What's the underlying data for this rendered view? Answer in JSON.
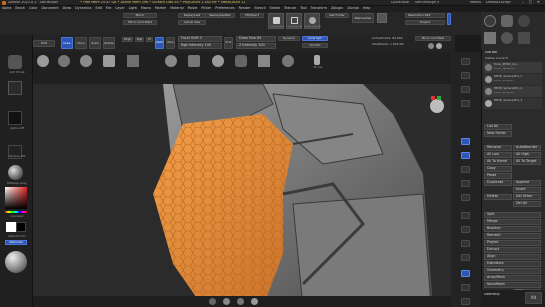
{
  "titlebar": {
    "title": "ZBrush 2022.0.1 · ZBrushDoc",
    "stats": "• Free Mem 25.47 GB • Active Mem 598 • Scratch Disk 45 • PolyCount 1.160 MP • MeshCount 11",
    "quicksave": "QuickSave",
    "seethrough": "See-through 0",
    "menus_label": "Menus",
    "default_zscript": "DefaultZScript"
  },
  "menubar": [
    "Alpha",
    "Brush",
    "Color",
    "Document",
    "Draw",
    "Dynamics",
    "Edit",
    "File",
    "Layer",
    "Light",
    "Macro",
    "Marker",
    "Material",
    "Movie",
    "Picker",
    "Preferences",
    "Render",
    "Stencil",
    "Stroke",
    "Texture",
    "Tool",
    "Transform",
    "Zplugin",
    "Zscript",
    "Help"
  ],
  "toolbar_top": {
    "mirror": "Mirror",
    "mirror_weld": "Mirror And Weld",
    "replay_last": "ReplayLast",
    "replay_last_rel": "ReplayLastRel",
    "actual_size": "Actual Size",
    "fill_object": "FillObject",
    "dynamesh": "DynaMesh",
    "zremesher": "ZRemesher",
    "zremesh_guide": "ZRemesherGuide",
    "get_folder": "Get Folder",
    "zremesh2": "ZRemesher",
    "resolution": "Resolution 464",
    "projection": "Project",
    "backface": "BackfaceMask",
    "subtool_label": "Subtool"
  },
  "toolbar_second": {
    "label": "GALAXIS_SITE",
    "edit_btn": "Edit",
    "draw": "Draw",
    "move": "Move",
    "scale": "Scale",
    "rotate": "Rotate",
    "mrgb": "Mrgb",
    "rgb": "Rgb",
    "m": "M",
    "zadd": "Zadd",
    "zsub": "Zsub",
    "zcut": "Zcut",
    "focal_shift": "Focal Shift 0",
    "draw_size": "Draw Size 64",
    "rgb_intensity": "Rgb Intensity 100",
    "z_intensity": "Z Intensity 100",
    "dyn": "Dynamic",
    "active_points": "ActivePoints: 82,682",
    "total_points": "TotalPoints: 1.622 Mil",
    "local_sym": "Local Sym",
    "mirror_x": "Mirror And Weld",
    "smooth": "Smooth"
  },
  "brush_row": {
    "label": "BrushRow",
    "items": [
      "Standard",
      "Move",
      "ClayBuildup",
      "DamStandard",
      "hPolish",
      "TrimDynamic",
      "Inflate",
      "Pinch",
      "SnakeHook",
      "Slash",
      "Chisel",
      "Cloth",
      "Prune"
    ],
    "prune": "Prune"
  },
  "left_panel": {
    "add_mode": "Add Mode",
    "alpha_off": "Alpha Off",
    "texture_off": "Texture Off",
    "matcap_gray": "MatCap Gray",
    "gradient": "Gradient",
    "switch_color": "SwitchColor",
    "alternate": "Alternate"
  },
  "right_panel": {
    "header": "SubTool",
    "visible_count": "Visible Count 8",
    "items": [
      {
        "name": "Torso_PM3D_Cyl...",
        "sub": "PM3D_Sphere3D"
      },
      {
        "name": "PM3D_Sphere3D1_1",
        "sub": "PM3D_Ring3D1"
      },
      {
        "name": "PM3D_Sphere3D1_2",
        "sub": "PM3D_Ring3D2"
      },
      {
        "name": "PM3D_Sphere3D1_3",
        "sub": ""
      }
    ],
    "list_all": "List All",
    "new_folder": "New Folder",
    "rename": "Rename",
    "auto_reorder": "AutoReorder",
    "all_low": "All Low",
    "all_high": "All High",
    "all_to_home": "All To Home",
    "all_to_target": "All To Target",
    "copy": "Copy",
    "paste": "Paste",
    "duplicate": "Duplicate",
    "append": "Append",
    "insert": "Insert",
    "delete": "Delete",
    "del_other": "Del Other",
    "del_all": "Del All",
    "split": "Split",
    "merge": "Merge",
    "boolean": "Boolean",
    "remesh": "Remesh",
    "project": "Project",
    "extract": "Extract",
    "align": "Align",
    "distribute": "Distribute",
    "geometry": "Geometry",
    "array_mesh": "ArrayMesh",
    "nanomesh": "NanoMesh",
    "layers": "Layers",
    "fibermesh": "FiberMesh",
    "geometry_hd": "Geometry HD",
    "preview": "Preview",
    "surface": "Surface",
    "deformation": "Deformation",
    "alt_btn": "Alt",
    "subtitle": "Geometry",
    "x_flip": "Y Flip",
    "total_btn": "Total"
  },
  "right_icons": [
    "Scroll",
    "Zoom",
    "Actual",
    "AAHalf",
    "Persp",
    "Floor",
    "Local",
    "LSym",
    "Xyz",
    "Frame",
    "Move",
    "Scale",
    "Rotate",
    "Line Fill",
    "PolyF",
    "Transp",
    "Ghost",
    "Solo",
    "Xpose"
  ],
  "colors": {
    "background": "#1b1b1b",
    "panel": "#2b2b2b",
    "accent_blue": "#2e56b8",
    "orange_surface": "#e58a36",
    "gray_model": "#7a7a7a"
  }
}
